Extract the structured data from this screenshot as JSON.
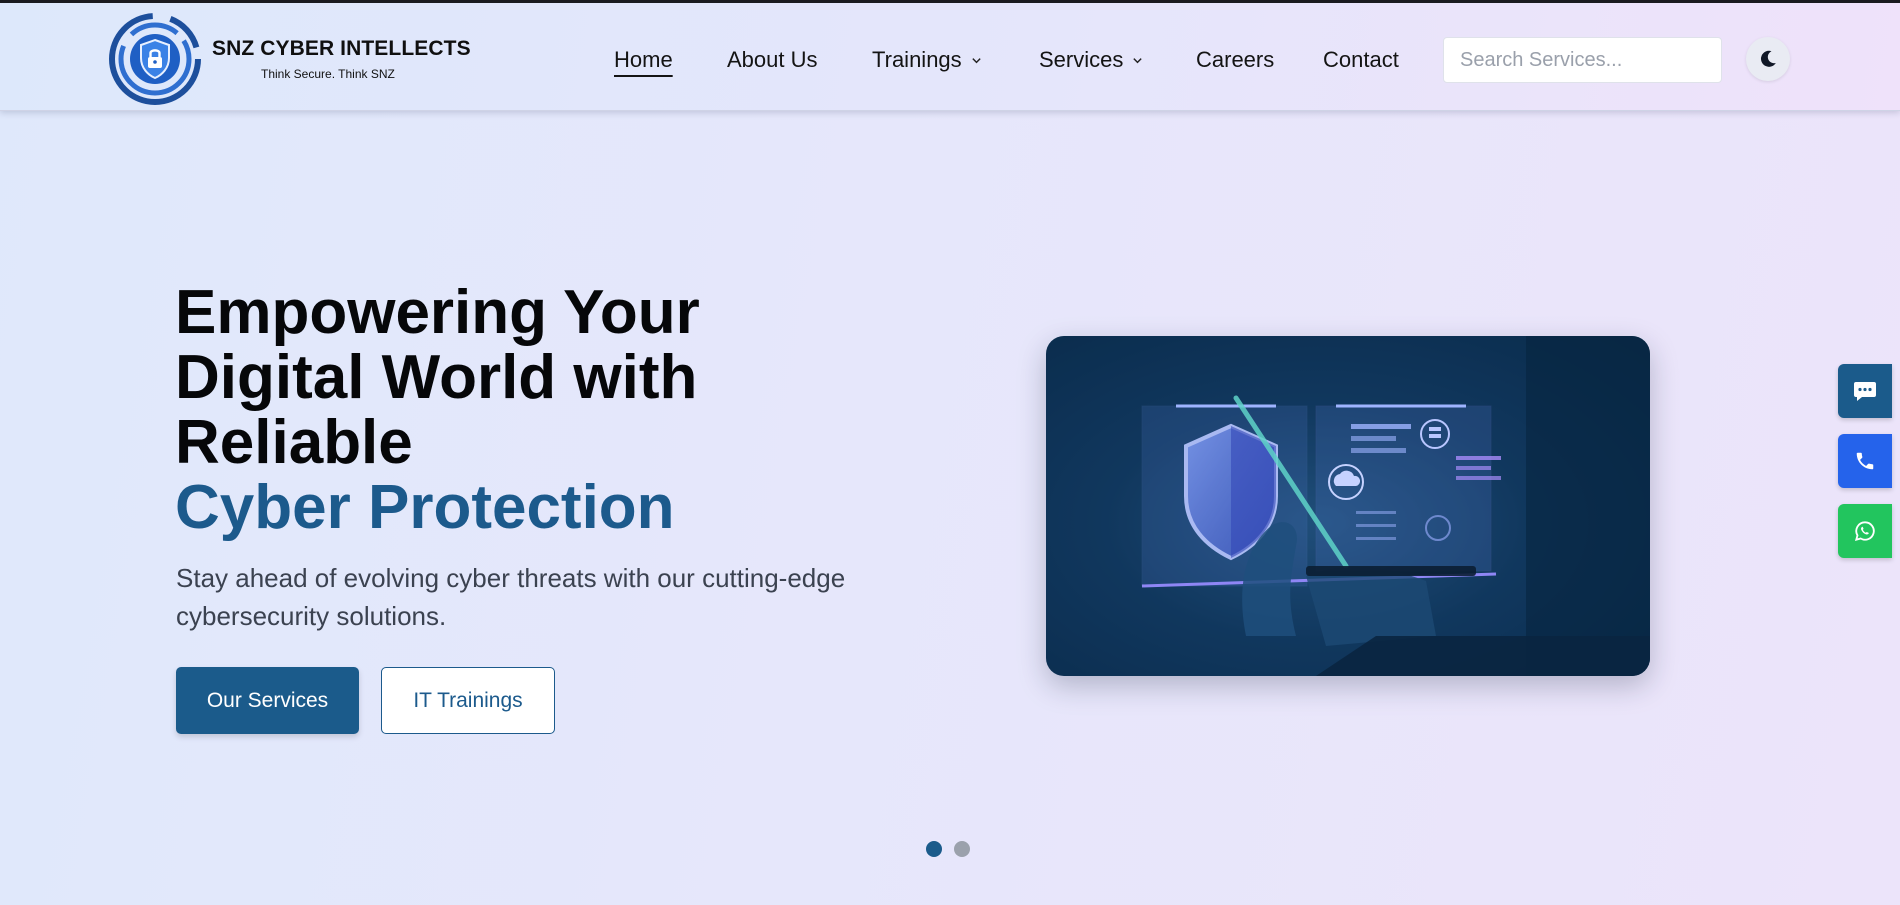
{
  "brand": {
    "name": "SNZ CYBER INTELLECTS",
    "tagline": "Think Secure. Think SNZ",
    "logo_icon": "shield-lock-logo"
  },
  "nav": {
    "items": [
      {
        "label": "Home",
        "active": true
      },
      {
        "label": "About Us"
      },
      {
        "label": "Trainings",
        "has_dropdown": true
      },
      {
        "label": "Services",
        "has_dropdown": true
      },
      {
        "label": "Careers"
      },
      {
        "label": "Contact"
      }
    ]
  },
  "search": {
    "placeholder": "Search Services..."
  },
  "theme_toggle": {
    "icon": "moon-icon"
  },
  "hero": {
    "title_lines": [
      "Empowering Your",
      "Digital World with",
      "Reliable"
    ],
    "title_accent": "Cyber Protection",
    "subtitle": "Stay ahead of evolving cyber threats with our cutting-edge cybersecurity solutions.",
    "primary_button": "Our Services",
    "secondary_button": "IT Trainings",
    "image_icon": "cyber-security-shield-image"
  },
  "carousel": {
    "slides": 2,
    "active_index": 0
  },
  "side_actions": [
    {
      "name": "chat",
      "icon": "chat-icon"
    },
    {
      "name": "call",
      "icon": "phone-icon"
    },
    {
      "name": "whatsapp",
      "icon": "whatsapp-icon"
    }
  ],
  "colors": {
    "accent": "#1c5a8c",
    "primary_button": "#1b5b8b",
    "call_button": "#2563eb",
    "whatsapp_button": "#22c55e"
  }
}
